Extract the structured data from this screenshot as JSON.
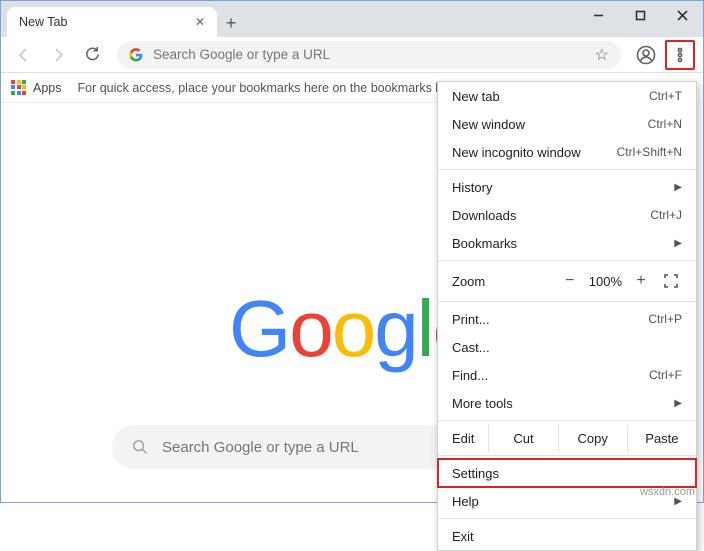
{
  "titlebar": {
    "tab_title": "New Tab"
  },
  "toolbar": {
    "omnibox_placeholder": "Search Google or type a URL"
  },
  "bookmark_bar": {
    "apps_label": "Apps",
    "hint": "For quick access, place your bookmarks here on the bookmarks ba"
  },
  "content": {
    "logo_letters": [
      "G",
      "o",
      "o",
      "g",
      "l",
      "e"
    ],
    "search_placeholder": "Search Google or type a URL"
  },
  "menu": {
    "new_tab": "New tab",
    "new_tab_sc": "Ctrl+T",
    "new_window": "New window",
    "new_window_sc": "Ctrl+N",
    "incognito": "New incognito window",
    "incognito_sc": "Ctrl+Shift+N",
    "history": "History",
    "downloads": "Downloads",
    "downloads_sc": "Ctrl+J",
    "bookmarks": "Bookmarks",
    "zoom_label": "Zoom",
    "zoom_value": "100%",
    "print": "Print...",
    "print_sc": "Ctrl+P",
    "cast": "Cast...",
    "find": "Find...",
    "find_sc": "Ctrl+F",
    "more_tools": "More tools",
    "edit": "Edit",
    "cut": "Cut",
    "copy": "Copy",
    "paste": "Paste",
    "settings": "Settings",
    "help": "Help",
    "exit": "Exit"
  },
  "watermark": "wsxdn.com"
}
